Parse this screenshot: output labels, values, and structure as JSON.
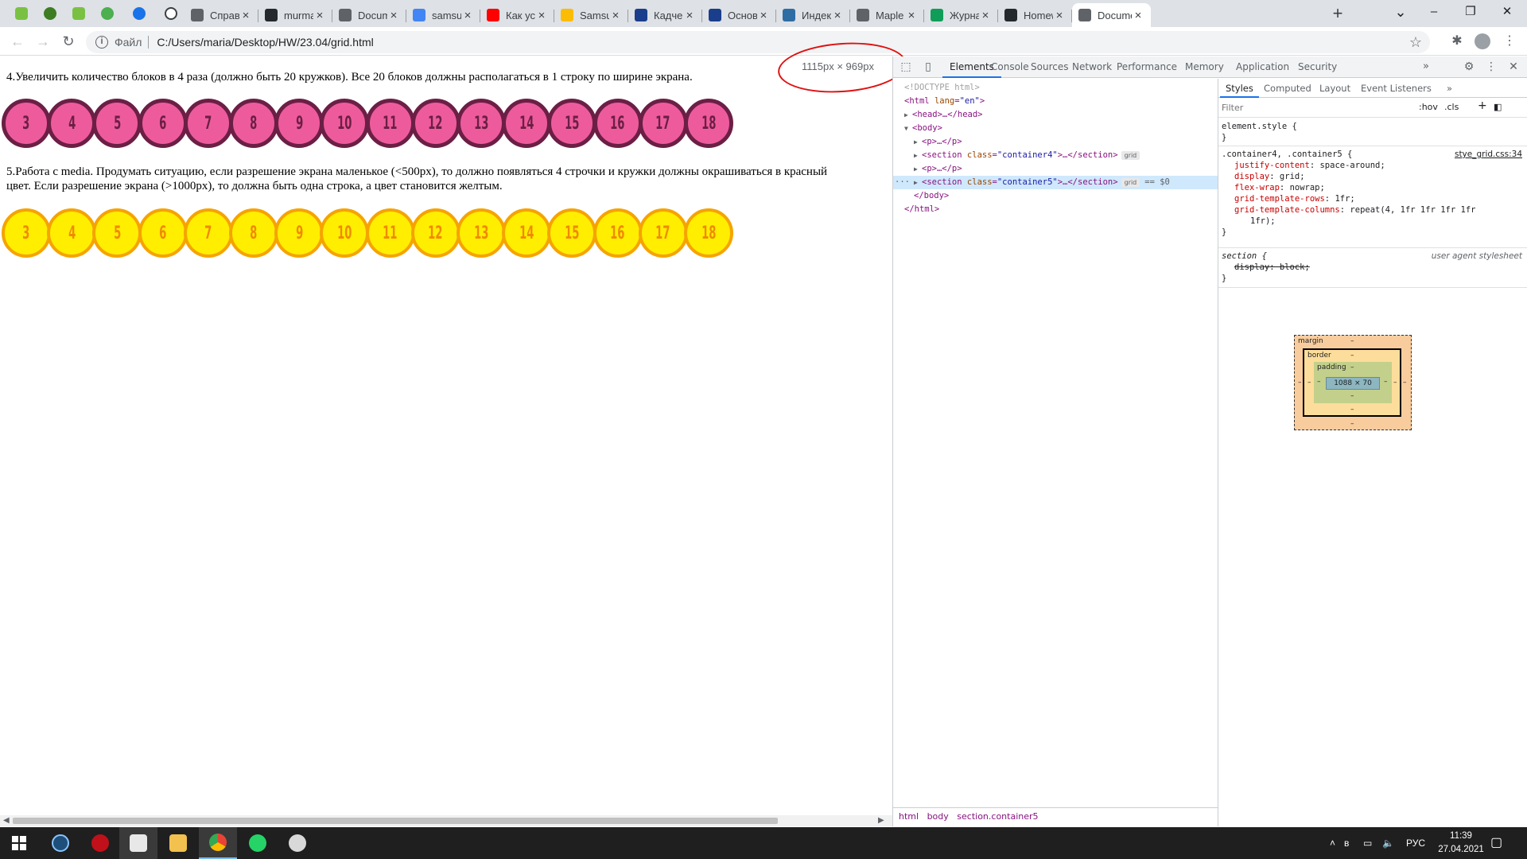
{
  "browser": {
    "pinned_tabs": [
      {
        "icon": "green-smiley-icon",
        "color": "#7ac143"
      },
      {
        "icon": "green-owl-icon",
        "color": "#3c7d23"
      },
      {
        "icon": "green-smiley-icon",
        "color": "#7ac143"
      },
      {
        "icon": "green-globe-icon",
        "color": "#4caf50"
      },
      {
        "icon": "share-nodes-icon",
        "color": "#1a73e8"
      },
      {
        "icon": "chat-bubble-icon",
        "color": "#3c4043"
      }
    ],
    "tabs": [
      {
        "title": "Справоч",
        "icon": "gear-icon",
        "color": "#5f6368"
      },
      {
        "title": "murmasl",
        "icon": "github-icon",
        "color": "#24292e"
      },
      {
        "title": "Docume",
        "icon": "globe-icon",
        "color": "#5f6368"
      },
      {
        "title": "samsung",
        "icon": "google-icon",
        "color": "#4285f4"
      },
      {
        "title": "Как уста",
        "icon": "youtube-icon",
        "color": "#ff0000"
      },
      {
        "title": "Samsung",
        "icon": "drive-icon",
        "color": "#fbbc04"
      },
      {
        "title": "Кадченк",
        "icon": "news-icon",
        "color": "#1a3e8c"
      },
      {
        "title": "Основы",
        "icon": "book-icon",
        "color": "#1a3e8c"
      },
      {
        "title": "Индекс",
        "icon": "ds-icon",
        "color": "#2e6da4"
      },
      {
        "title": "Maple E",
        "icon": "globe-icon",
        "color": "#5f6368"
      },
      {
        "title": "Журнал",
        "icon": "drive-icon",
        "color": "#0f9d58"
      },
      {
        "title": "Homew",
        "icon": "github-icon",
        "color": "#24292e"
      },
      {
        "title": "Docume",
        "icon": "globe-icon",
        "color": "#5f6368",
        "active": true
      }
    ],
    "new_tab": "+",
    "window_controls": {
      "minimize": "–",
      "restore": "❐",
      "close": "✕"
    },
    "address": {
      "protocol": "Файл",
      "url": "C:/Users/maria/Desktop/HW/23.04/grid.html"
    }
  },
  "page": {
    "task4": "4.Увеличить количество блоков в 4 раза (должно быть 20 кружков). Все 20 блоков должны располагаться в 1 строку по ширине экрана.",
    "task5": "5.Работа с media. Продумать ситуацию, если разрешение экрана маленькое (<500px), то должно появляться 4 строчки и кружки должны окрашиваться в красный цвет. Если разрешение экрана (>1000px), то должна быть одна строка, а цвет становится желтым.",
    "pink_circles": [
      "3",
      "4",
      "5",
      "6",
      "7",
      "8",
      "9",
      "10",
      "11",
      "12",
      "13",
      "14",
      "15",
      "16",
      "17",
      "18"
    ],
    "yellow_circles": [
      "3",
      "4",
      "5",
      "6",
      "7",
      "8",
      "9",
      "10",
      "11",
      "12",
      "13",
      "14",
      "15",
      "16",
      "17",
      "18"
    ],
    "viewport_size": "1115px × 969px"
  },
  "devtools": {
    "tabs": [
      "Elements",
      "Console",
      "Sources",
      "Network",
      "Performance",
      "Memory",
      "Application",
      "Security"
    ],
    "more": "»",
    "dom": {
      "doctype": "<!DOCTYPE html>",
      "html_tag": "html",
      "html_attr_name": "lang",
      "html_attr_value": "\"en\"",
      "head": "<head>…</head>",
      "body_open": "<body>",
      "p1": "<p>…</p>",
      "section_tag": "section",
      "class_attr": "class",
      "container4": "\"container4\"",
      "container5": "\"container5\"",
      "grid_badge": "grid",
      "ellipsis_close": ">…</section>",
      "p2": "<p>…</p>",
      "selected_marker": "== $0",
      "body_close": "</body>",
      "html_close": "</html>"
    },
    "breadcrumbs": [
      "html",
      "body",
      "section.container5"
    ],
    "styles": {
      "tabs": [
        "Styles",
        "Computed",
        "Layout",
        "Event Listeners"
      ],
      "more": "»",
      "filter_placeholder": "Filter",
      "hov": ":hov",
      "cls": ".cls",
      "element_style": "element.style {",
      "close_brace": "}",
      "rule_selector": ".container4, .container5 {",
      "rule_source": "stye_grid.css:34",
      "props": [
        {
          "name": "justify-content",
          "value": "space-around;"
        },
        {
          "name": "display",
          "value": "grid;"
        },
        {
          "name": "flex-wrap",
          "value": "nowrap;"
        },
        {
          "name": "grid-template-rows",
          "value": "1fr;"
        },
        {
          "name": "grid-template-columns",
          "value": "repeat(4, 1fr 1fr 1fr 1fr"
        },
        {
          "name": "",
          "value": "1fr);"
        }
      ],
      "ua_selector": "section {",
      "ua_source": "user agent stylesheet",
      "ua_prop": "display: block;"
    },
    "box_model": {
      "margin": "margin",
      "border": "border",
      "padding": "padding",
      "dash": "–",
      "content": "1088 × 70"
    }
  },
  "taskbar": {
    "apps": [
      {
        "icon": "windows-start-icon"
      },
      {
        "icon": "clock-app-icon"
      },
      {
        "icon": "red-app-icon"
      },
      {
        "icon": "calculator-icon"
      },
      {
        "icon": "file-explorer-icon"
      },
      {
        "icon": "chrome-icon",
        "active": true
      },
      {
        "icon": "whatsapp-icon"
      },
      {
        "icon": "paint-icon"
      }
    ],
    "lang": "РУС",
    "time": "11:39",
    "date": "27.04.2021"
  }
}
